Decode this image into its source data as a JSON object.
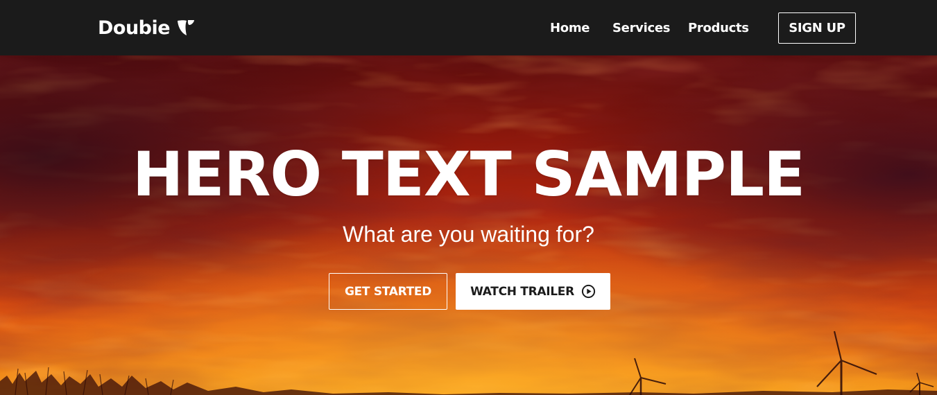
{
  "navbar": {
    "brand": "Doubie",
    "brand_icon": "typo3-logo-icon",
    "links": [
      {
        "label": "Home"
      },
      {
        "label": "Services"
      },
      {
        "label": "Products"
      }
    ],
    "signup_label": "SIGN UP"
  },
  "hero": {
    "title": "HERO TEXT SAMPLE",
    "subtitle": "What are you waiting for?",
    "primary_cta": "GET STARTED",
    "secondary_cta": "WATCH TRAILER",
    "secondary_cta_icon": "play-circle-icon",
    "background": "sunset-sky-with-wind-turbines"
  },
  "colors": {
    "nav_bg": "#1b1b1b",
    "text": "#ffffff",
    "sky_red": "#b8200c",
    "sky_orange": "#ea6a14",
    "button_solid_bg": "#ffffff",
    "button_solid_text": "#1b1b1b"
  }
}
